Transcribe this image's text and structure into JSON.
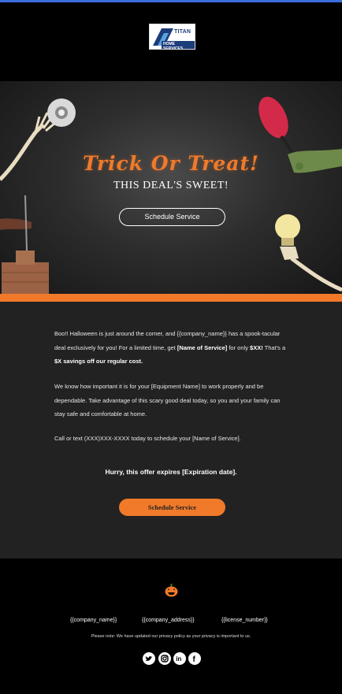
{
  "brand": {
    "logo_line1": "TITAN",
    "logo_line2": "HOME SERVICES",
    "accent": "#f07a2a",
    "topbar": "#3b6fe0"
  },
  "hero": {
    "title": "Trick Or Treat!",
    "subtitle": "THIS DEAL'S SWEET!",
    "button_label": "Schedule Service"
  },
  "body": {
    "p1_a": "Boo!! Halloween is just around the corner, and {{company_name}} has a spook-tacular deal exclusively for you! For a limited time, get ",
    "p1_b": "[Name of Service]",
    "p1_c": " for only ",
    "p1_d": "$XX!",
    "p1_e": " That's a ",
    "p1_f": "$X savings off our regular cost.",
    "p2": "We know how important it is for your [Equipment Name] to work properly and be dependable. Take advantage of this scary good deal today, so you and your family can stay safe and comfortable at home.",
    "p3": "Call or text (XXX)XXX-XXXX today to schedule your [Name of Service].",
    "hurry": "Hurry, this offer expires [Expiration date].",
    "cta_label": "Schedule Service"
  },
  "footer": {
    "company_name": "{{company_name}}",
    "company_address": "{{company_address}}",
    "license_number": "{{license_number}}",
    "note": "Please note: We have updated our privacy policy as your privacy is important to us.",
    "social": [
      "twitter-icon",
      "instagram-icon",
      "linkedin-icon",
      "facebook-icon"
    ]
  }
}
